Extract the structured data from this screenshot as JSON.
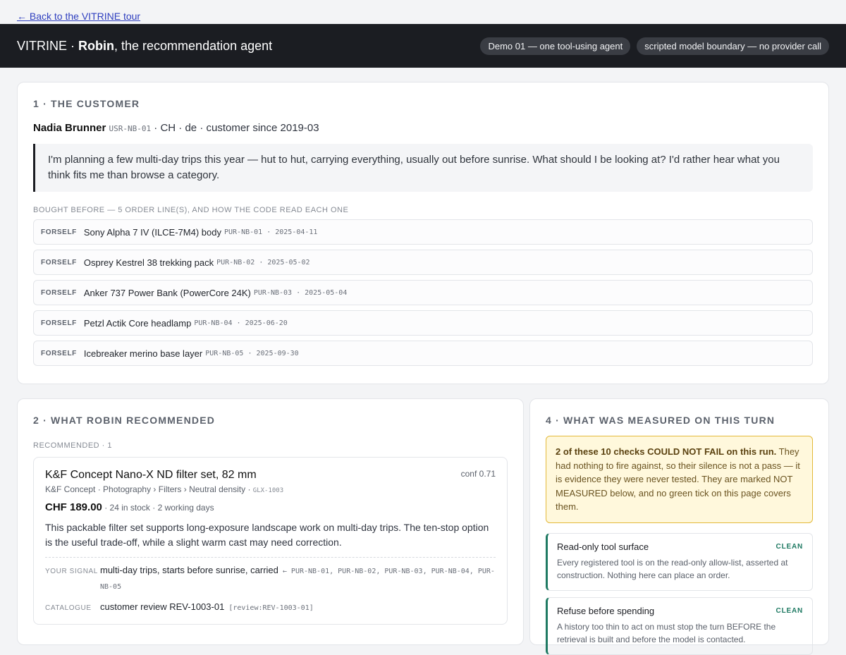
{
  "nav": {
    "back_link": "← Back to the VITRINE tour"
  },
  "header": {
    "brand_prefix": "VITRINE · ",
    "brand_name": "Robin",
    "brand_suffix": ", the recommendation agent",
    "chips": [
      "Demo 01 — one tool-using agent",
      "scripted model boundary — no provider call"
    ]
  },
  "customer": {
    "section_title": "1 · THE CUSTOMER",
    "name": "Nadia Brunner",
    "user_id": "USR-NB-01",
    "details": " · CH · de · customer since 2019-03",
    "message": "I'm planning a few multi-day trips this year — hut to hut, carrying everything, usually out before sunrise. What should I be looking at? I'd rather hear what you think fits me than browse a category.",
    "history_label": "BOUGHT BEFORE — 5 ORDER LINE(S), AND HOW THE CODE READ EACH ONE",
    "history": [
      {
        "tag": "FORSELF",
        "name": "Sony Alpha 7 IV (ILCE-7M4) body",
        "id": "PUR-NB-01",
        "date": "2025-04-11"
      },
      {
        "tag": "FORSELF",
        "name": "Osprey Kestrel 38 trekking pack",
        "id": "PUR-NB-02",
        "date": "2025-05-02"
      },
      {
        "tag": "FORSELF",
        "name": "Anker 737 Power Bank (PowerCore 24K)",
        "id": "PUR-NB-03",
        "date": "2025-05-04"
      },
      {
        "tag": "FORSELF",
        "name": "Petzl Actik Core headlamp",
        "id": "PUR-NB-04",
        "date": "2025-06-20"
      },
      {
        "tag": "FORSELF",
        "name": "Icebreaker merino base layer",
        "id": "PUR-NB-05",
        "date": "2025-09-30"
      }
    ]
  },
  "recommendation": {
    "section_title": "2 · WHAT ROBIN RECOMMENDED",
    "label": "RECOMMENDED · 1",
    "product": {
      "name": "K&F Concept Nano-X ND filter set, 82 mm",
      "confidence": "conf 0.71",
      "path": "K&F Concept · Photography › Filters › Neutral density · ",
      "sku": "GLX-1003",
      "price": "CHF 189.00",
      "stock": " · 24 in stock · 2 working days",
      "description": "This packable filter set supports long-exposure landscape work on multi-day trips. The ten-stop option is the useful trade-off, while a slight warm cast may need correction.",
      "signal_label": "YOUR SIGNAL",
      "signal_text": "multi-day trips, starts before sunrise, carried",
      "signal_refs": " ← PUR-NB-01, PUR-NB-02, PUR-NB-03, PUR-NB-04, PUR-NB-05",
      "catalogue_label": "CATALOGUE",
      "catalogue_text": "customer review REV-1003-01",
      "catalogue_ref": " [review:REV-1003-01]"
    }
  },
  "measurement": {
    "section_title": "4 · WHAT WAS MEASURED ON THIS TURN",
    "warning_bold": "2 of these 10 checks COULD NOT FAIL on this run.",
    "warning_text": " They had nothing to fire against, so their silence is not a pass — it is evidence they were never tested. They are marked NOT MEASURED below, and no green tick on this page covers them.",
    "checks": [
      {
        "title": "Read-only tool surface",
        "status": "CLEAN",
        "description": "Every registered tool is on the read-only allow-list, asserted at construction. Nothing here can place an order."
      },
      {
        "title": "Refuse before spending",
        "status": "CLEAN",
        "description": "A history too thin to act on must stop the turn BEFORE the retrieval is built and before the model is contacted."
      }
    ]
  },
  "colors": {
    "accent_dark": "#1b1d22",
    "clean_green": "#1f7a63",
    "warning_bg": "#fff8dc",
    "warning_border": "#e3b93a",
    "link_blue": "#2f3fbf"
  }
}
